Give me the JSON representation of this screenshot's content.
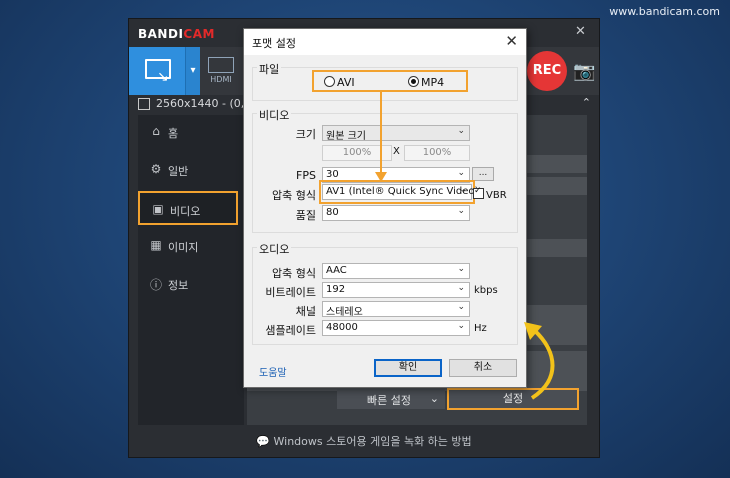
{
  "watermark": "www.bandicam.com",
  "app": {
    "logo_main": "BANDI",
    "logo_accent": "CAM",
    "rec_label": "REC",
    "hdmi_label": "HDMI",
    "resolution_text": "2560x1440 - (0, 0), (",
    "sidebar": [
      {
        "label": "홈",
        "icon": "home-icon"
      },
      {
        "label": "일반",
        "icon": "gear-icon"
      },
      {
        "label": "비디오",
        "icon": "video-settings-icon"
      },
      {
        "label": "이미지",
        "icon": "image-icon"
      },
      {
        "label": "정보",
        "icon": "info-icon"
      }
    ],
    "quick_settings_label": "빠른 설정",
    "settings_label": "설정",
    "footer_tip": "Windows 스토어용 게임을 녹화 하는 방법",
    "accent_color": "#f2a22f",
    "brand_blue": "#2f8fde",
    "rec_red": "#e53636"
  },
  "dialog": {
    "title": "포맷 설정",
    "file_group": "파일",
    "formats": [
      {
        "label": "AVI",
        "selected": false
      },
      {
        "label": "MP4",
        "selected": true
      }
    ],
    "video_group": "비디오",
    "size_label": "크기",
    "size_value": "원본 크기",
    "width_pct": "100%",
    "times": "X",
    "height_pct": "100%",
    "fps_label": "FPS",
    "fps_value": "30",
    "more_button": "...",
    "codec_label": "압축 형식",
    "codec_value": "AV1 (Intel® Quick Sync Video)",
    "vbr_label": "VBR",
    "quality_label": "품질",
    "quality_value": "80",
    "audio_group": "오디오",
    "audio_codec_label": "압축 형식",
    "audio_codec_value": "AAC",
    "bitrate_label": "비트레이트",
    "bitrate_value": "192",
    "bitrate_unit": "kbps",
    "channel_label": "채널",
    "channel_value": "스테레오",
    "samplerate_label": "샘플레이트",
    "samplerate_value": "48000",
    "samplerate_unit": "Hz",
    "help_link": "도움말",
    "ok_button": "확인",
    "cancel_button": "취소"
  }
}
